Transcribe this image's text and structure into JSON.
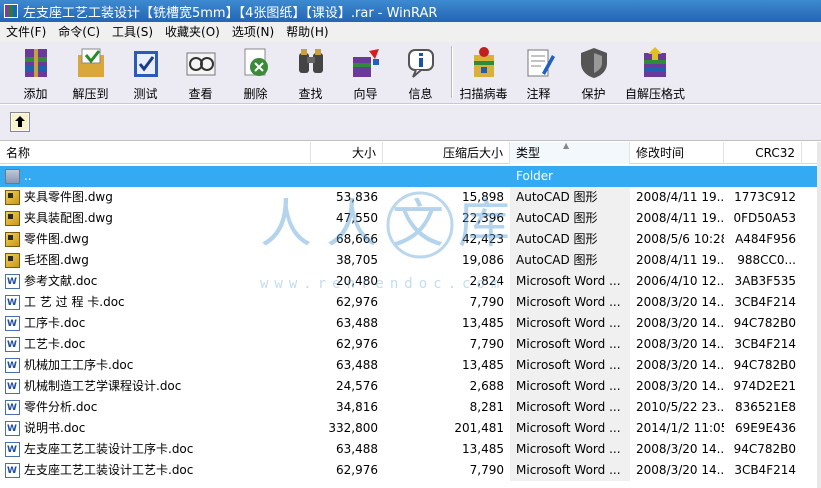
{
  "window": {
    "title": "左支座工艺工装设计【铣槽宽5mm】【4张图纸】【课设】.rar - WinRAR"
  },
  "menu": [
    "文件(F)",
    "命令(C)",
    "工具(S)",
    "收藏夹(O)",
    "选项(N)",
    "帮助(H)"
  ],
  "toolbar": [
    {
      "label": "添加",
      "icon": "add-archive-icon"
    },
    {
      "label": "解压到",
      "icon": "extract-to-icon"
    },
    {
      "label": "测试",
      "icon": "test-icon"
    },
    {
      "label": "查看",
      "icon": "view-icon"
    },
    {
      "label": "删除",
      "icon": "delete-icon"
    },
    {
      "label": "查找",
      "icon": "find-icon"
    },
    {
      "label": "向导",
      "icon": "wizard-icon"
    },
    {
      "label": "信息",
      "icon": "info-icon"
    },
    {
      "label": "扫描病毒",
      "icon": "virus-scan-icon"
    },
    {
      "label": "注释",
      "icon": "comment-icon"
    },
    {
      "label": "保护",
      "icon": "protect-icon"
    },
    {
      "label": "自解压格式",
      "icon": "sfx-icon"
    }
  ],
  "columns": [
    "名称",
    "大小",
    "压缩后大小",
    "类型",
    "修改时间",
    "CRC32"
  ],
  "files": [
    {
      "name": "..",
      "size": "",
      "packed": "",
      "type": "Folder",
      "modified": "",
      "crc": "",
      "icon": "folder",
      "selected": true
    },
    {
      "name": "夹具零件图.dwg",
      "size": "53,836",
      "packed": "15,898",
      "type": "AutoCAD 图形",
      "modified": "2008/4/11 19...",
      "crc": "1773C912",
      "icon": "dwg"
    },
    {
      "name": "夹具装配图.dwg",
      "size": "47,550",
      "packed": "22,396",
      "type": "AutoCAD 图形",
      "modified": "2008/4/11 19...",
      "crc": "0FD50A53",
      "icon": "dwg"
    },
    {
      "name": "零件图.dwg",
      "size": "68,666",
      "packed": "42,423",
      "type": "AutoCAD 图形",
      "modified": "2008/5/6 10:28",
      "crc": "A484F956",
      "icon": "dwg"
    },
    {
      "name": "毛坯图.dwg",
      "size": "38,705",
      "packed": "19,086",
      "type": "AutoCAD 图形",
      "modified": "2008/4/11 19...",
      "crc": "988CC0...",
      "icon": "dwg"
    },
    {
      "name": "参考文献.doc",
      "size": "20,480",
      "packed": "2,824",
      "type": "Microsoft Word ...",
      "modified": "2006/4/10 12...",
      "crc": "3AB3F535",
      "icon": "doc"
    },
    {
      "name": "工 艺 过 程 卡.doc",
      "size": "62,976",
      "packed": "7,790",
      "type": "Microsoft Word ...",
      "modified": "2008/3/20 14...",
      "crc": "3CB4F214",
      "icon": "doc"
    },
    {
      "name": "工序卡.doc",
      "size": "63,488",
      "packed": "13,485",
      "type": "Microsoft Word ...",
      "modified": "2008/3/20 14...",
      "crc": "94C782B0",
      "icon": "doc"
    },
    {
      "name": "工艺卡.doc",
      "size": "62,976",
      "packed": "7,790",
      "type": "Microsoft Word ...",
      "modified": "2008/3/20 14...",
      "crc": "3CB4F214",
      "icon": "doc"
    },
    {
      "name": "机械加工工序卡.doc",
      "size": "63,488",
      "packed": "13,485",
      "type": "Microsoft Word ...",
      "modified": "2008/3/20 14...",
      "crc": "94C782B0",
      "icon": "doc"
    },
    {
      "name": "机械制造工艺学课程设计.doc",
      "size": "24,576",
      "packed": "2,688",
      "type": "Microsoft Word ...",
      "modified": "2008/3/20 14...",
      "crc": "974D2E21",
      "icon": "doc"
    },
    {
      "name": "零件分析.doc",
      "size": "34,816",
      "packed": "8,281",
      "type": "Microsoft Word ...",
      "modified": "2010/5/22 23...",
      "crc": "836521E8",
      "icon": "doc"
    },
    {
      "name": "说明书.doc",
      "size": "332,800",
      "packed": "201,481",
      "type": "Microsoft Word ...",
      "modified": "2014/1/2 11:05",
      "crc": "69E9E436",
      "icon": "doc"
    },
    {
      "name": "左支座工艺工装设计工序卡.doc",
      "size": "63,488",
      "packed": "13,485",
      "type": "Microsoft Word ...",
      "modified": "2008/3/20 14...",
      "crc": "94C782B0",
      "icon": "doc"
    },
    {
      "name": "左支座工艺工装设计工艺卡.doc",
      "size": "62,976",
      "packed": "7,790",
      "type": "Microsoft Word ...",
      "modified": "2008/3/20 14...",
      "crc": "3CB4F214",
      "icon": "doc"
    }
  ],
  "watermark": {
    "text": "人人文库",
    "url": "www.renrendoc.com"
  },
  "colors": {
    "title_bar": "#2d78c6",
    "toolbar_bg": "#ecebf4",
    "selection": "#33aaf2"
  }
}
